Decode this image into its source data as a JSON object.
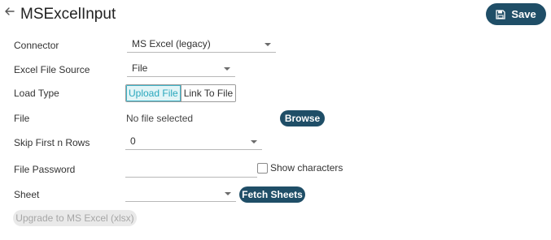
{
  "header": {
    "title": "MSExcelInput",
    "save_label": "Save"
  },
  "form": {
    "connector": {
      "label": "Connector",
      "value": "MS Excel (legacy)"
    },
    "excel_file_source": {
      "label": "Excel File Source",
      "value": "File"
    },
    "load_type": {
      "label": "Load Type",
      "options": [
        "Upload File",
        "Link To File"
      ],
      "selected": "Upload File"
    },
    "file": {
      "label": "File",
      "status": "No file selected",
      "browse_label": "Browse"
    },
    "skip_first_n_rows": {
      "label": "Skip First n Rows",
      "value": "0"
    },
    "file_password": {
      "label": "File Password",
      "value": "",
      "show_characters_label": "Show characters",
      "show_characters_checked": false
    },
    "sheet": {
      "label": "Sheet",
      "value": "",
      "fetch_label": "Fetch Sheets"
    },
    "upgrade_label": "Upgrade to MS Excel (xlsx)"
  },
  "colors": {
    "primary_button": "#1f4e67",
    "toggle_active_text": "#2aa7bd",
    "toggle_active_bg": "#e2f5f7",
    "disabled_button_bg": "#e9e9e9"
  },
  "icons": {
    "back": "arrow-left-icon",
    "save": "floppy-disk-icon",
    "dropdown": "caret-down-icon"
  }
}
